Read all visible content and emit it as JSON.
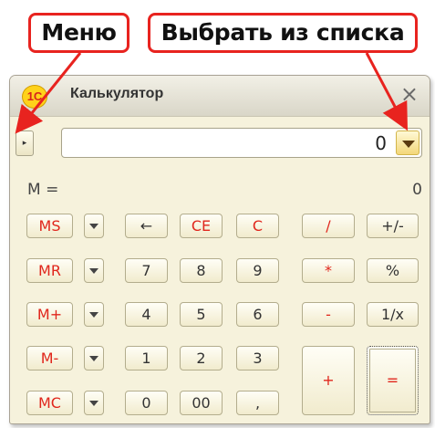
{
  "callouts": {
    "menu": "Меню",
    "select_from_list": "Выбрать из списка"
  },
  "window": {
    "title": "Калькулятор",
    "logo_text": "1С",
    "close_glyph": "×"
  },
  "display": {
    "value": "0",
    "menu_glyph": "▸"
  },
  "memory": {
    "label": "M =",
    "value": "0"
  },
  "buttons": {
    "ms": "MS",
    "mr": "MR",
    "m_plus": "M+",
    "m_minus": "M-",
    "mc": "MC",
    "backspace": "←",
    "ce": "CE",
    "c": "C",
    "divide": "/",
    "plus_minus": "+/-",
    "seven": "7",
    "eight": "8",
    "nine": "9",
    "multiply": "*",
    "percent": "%",
    "four": "4",
    "five": "5",
    "six": "6",
    "minus": "-",
    "reciprocal": "1/x",
    "one": "1",
    "two": "2",
    "three": "3",
    "plus": "+",
    "equals": "=",
    "zero": "0",
    "double_zero": "00",
    "comma": ","
  },
  "colors": {
    "accent_red": "#e0261c",
    "window_bg": "#f6f2dc",
    "callout_border": "#e8231f"
  }
}
